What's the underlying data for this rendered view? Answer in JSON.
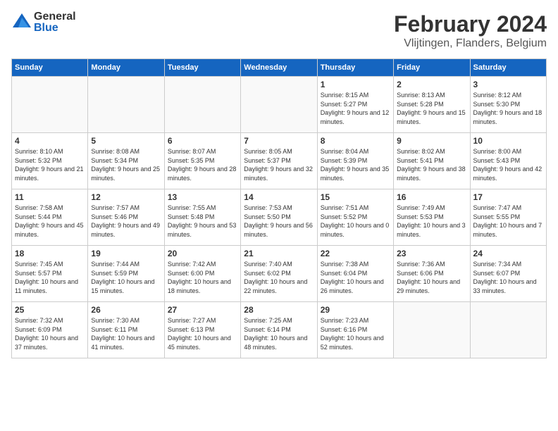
{
  "header": {
    "logo_general": "General",
    "logo_blue": "Blue",
    "month_title": "February 2024",
    "location": "Vlijtingen, Flanders, Belgium"
  },
  "weekdays": [
    "Sunday",
    "Monday",
    "Tuesday",
    "Wednesday",
    "Thursday",
    "Friday",
    "Saturday"
  ],
  "weeks": [
    [
      {
        "day": "",
        "sunrise": "",
        "sunset": "",
        "daylight": ""
      },
      {
        "day": "",
        "sunrise": "",
        "sunset": "",
        "daylight": ""
      },
      {
        "day": "",
        "sunrise": "",
        "sunset": "",
        "daylight": ""
      },
      {
        "day": "",
        "sunrise": "",
        "sunset": "",
        "daylight": ""
      },
      {
        "day": "1",
        "sunrise": "Sunrise: 8:15 AM",
        "sunset": "Sunset: 5:27 PM",
        "daylight": "Daylight: 9 hours and 12 minutes."
      },
      {
        "day": "2",
        "sunrise": "Sunrise: 8:13 AM",
        "sunset": "Sunset: 5:28 PM",
        "daylight": "Daylight: 9 hours and 15 minutes."
      },
      {
        "day": "3",
        "sunrise": "Sunrise: 8:12 AM",
        "sunset": "Sunset: 5:30 PM",
        "daylight": "Daylight: 9 hours and 18 minutes."
      }
    ],
    [
      {
        "day": "4",
        "sunrise": "Sunrise: 8:10 AM",
        "sunset": "Sunset: 5:32 PM",
        "daylight": "Daylight: 9 hours and 21 minutes."
      },
      {
        "day": "5",
        "sunrise": "Sunrise: 8:08 AM",
        "sunset": "Sunset: 5:34 PM",
        "daylight": "Daylight: 9 hours and 25 minutes."
      },
      {
        "day": "6",
        "sunrise": "Sunrise: 8:07 AM",
        "sunset": "Sunset: 5:35 PM",
        "daylight": "Daylight: 9 hours and 28 minutes."
      },
      {
        "day": "7",
        "sunrise": "Sunrise: 8:05 AM",
        "sunset": "Sunset: 5:37 PM",
        "daylight": "Daylight: 9 hours and 32 minutes."
      },
      {
        "day": "8",
        "sunrise": "Sunrise: 8:04 AM",
        "sunset": "Sunset: 5:39 PM",
        "daylight": "Daylight: 9 hours and 35 minutes."
      },
      {
        "day": "9",
        "sunrise": "Sunrise: 8:02 AM",
        "sunset": "Sunset: 5:41 PM",
        "daylight": "Daylight: 9 hours and 38 minutes."
      },
      {
        "day": "10",
        "sunrise": "Sunrise: 8:00 AM",
        "sunset": "Sunset: 5:43 PM",
        "daylight": "Daylight: 9 hours and 42 minutes."
      }
    ],
    [
      {
        "day": "11",
        "sunrise": "Sunrise: 7:58 AM",
        "sunset": "Sunset: 5:44 PM",
        "daylight": "Daylight: 9 hours and 45 minutes."
      },
      {
        "day": "12",
        "sunrise": "Sunrise: 7:57 AM",
        "sunset": "Sunset: 5:46 PM",
        "daylight": "Daylight: 9 hours and 49 minutes."
      },
      {
        "day": "13",
        "sunrise": "Sunrise: 7:55 AM",
        "sunset": "Sunset: 5:48 PM",
        "daylight": "Daylight: 9 hours and 53 minutes."
      },
      {
        "day": "14",
        "sunrise": "Sunrise: 7:53 AM",
        "sunset": "Sunset: 5:50 PM",
        "daylight": "Daylight: 9 hours and 56 minutes."
      },
      {
        "day": "15",
        "sunrise": "Sunrise: 7:51 AM",
        "sunset": "Sunset: 5:52 PM",
        "daylight": "Daylight: 10 hours and 0 minutes."
      },
      {
        "day": "16",
        "sunrise": "Sunrise: 7:49 AM",
        "sunset": "Sunset: 5:53 PM",
        "daylight": "Daylight: 10 hours and 3 minutes."
      },
      {
        "day": "17",
        "sunrise": "Sunrise: 7:47 AM",
        "sunset": "Sunset: 5:55 PM",
        "daylight": "Daylight: 10 hours and 7 minutes."
      }
    ],
    [
      {
        "day": "18",
        "sunrise": "Sunrise: 7:45 AM",
        "sunset": "Sunset: 5:57 PM",
        "daylight": "Daylight: 10 hours and 11 minutes."
      },
      {
        "day": "19",
        "sunrise": "Sunrise: 7:44 AM",
        "sunset": "Sunset: 5:59 PM",
        "daylight": "Daylight: 10 hours and 15 minutes."
      },
      {
        "day": "20",
        "sunrise": "Sunrise: 7:42 AM",
        "sunset": "Sunset: 6:00 PM",
        "daylight": "Daylight: 10 hours and 18 minutes."
      },
      {
        "day": "21",
        "sunrise": "Sunrise: 7:40 AM",
        "sunset": "Sunset: 6:02 PM",
        "daylight": "Daylight: 10 hours and 22 minutes."
      },
      {
        "day": "22",
        "sunrise": "Sunrise: 7:38 AM",
        "sunset": "Sunset: 6:04 PM",
        "daylight": "Daylight: 10 hours and 26 minutes."
      },
      {
        "day": "23",
        "sunrise": "Sunrise: 7:36 AM",
        "sunset": "Sunset: 6:06 PM",
        "daylight": "Daylight: 10 hours and 29 minutes."
      },
      {
        "day": "24",
        "sunrise": "Sunrise: 7:34 AM",
        "sunset": "Sunset: 6:07 PM",
        "daylight": "Daylight: 10 hours and 33 minutes."
      }
    ],
    [
      {
        "day": "25",
        "sunrise": "Sunrise: 7:32 AM",
        "sunset": "Sunset: 6:09 PM",
        "daylight": "Daylight: 10 hours and 37 minutes."
      },
      {
        "day": "26",
        "sunrise": "Sunrise: 7:30 AM",
        "sunset": "Sunset: 6:11 PM",
        "daylight": "Daylight: 10 hours and 41 minutes."
      },
      {
        "day": "27",
        "sunrise": "Sunrise: 7:27 AM",
        "sunset": "Sunset: 6:13 PM",
        "daylight": "Daylight: 10 hours and 45 minutes."
      },
      {
        "day": "28",
        "sunrise": "Sunrise: 7:25 AM",
        "sunset": "Sunset: 6:14 PM",
        "daylight": "Daylight: 10 hours and 48 minutes."
      },
      {
        "day": "29",
        "sunrise": "Sunrise: 7:23 AM",
        "sunset": "Sunset: 6:16 PM",
        "daylight": "Daylight: 10 hours and 52 minutes."
      },
      {
        "day": "",
        "sunrise": "",
        "sunset": "",
        "daylight": ""
      },
      {
        "day": "",
        "sunrise": "",
        "sunset": "",
        "daylight": ""
      }
    ]
  ]
}
